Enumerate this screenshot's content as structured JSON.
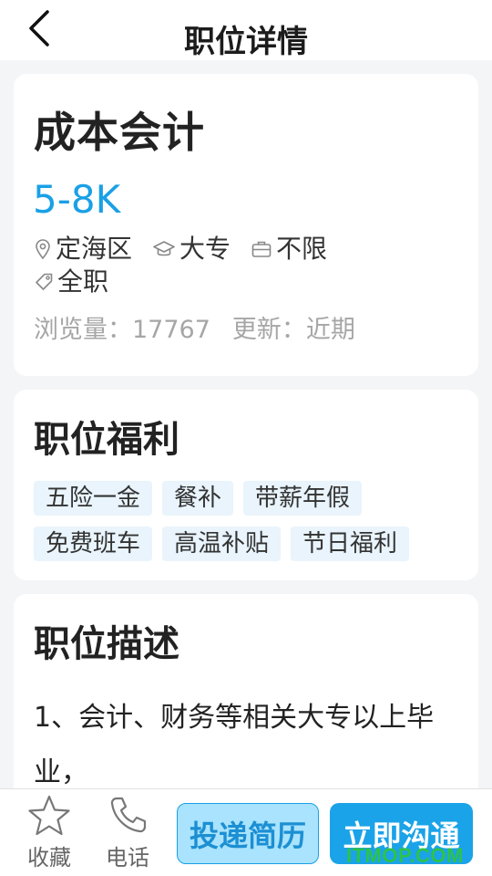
{
  "header": {
    "title": "职位详情",
    "back_icon": "chevron-left-icon"
  },
  "job": {
    "title": "成本会计",
    "salary": "5-8K",
    "location": "定海区",
    "education": "大专",
    "experience": "不限",
    "job_type": "全职",
    "views_label": "浏览量：",
    "views_value": "17767",
    "updated_label": "更新：",
    "updated_value": "近期"
  },
  "benefits": {
    "title": "职位福利",
    "tags": [
      "五险一金",
      "餐补",
      "带薪年假",
      "免费班车",
      "高温补贴",
      "节日福利"
    ]
  },
  "description": {
    "title": "职位描述",
    "text": "1、会计、财务等相关大专以上毕业，"
  },
  "bottom_bar": {
    "favorite_label": "收藏",
    "call_label": "电话",
    "resume_button": "投递简历",
    "chat_button": "立即沟通"
  },
  "watermark": "ITMOP.COM",
  "colors": {
    "accent": "#1aa0e6",
    "tag_background": "#e9f4fc",
    "resume_button_background": "#a9e3fd",
    "chat_button_background": "#1aa3e8",
    "muted_text": "#a6a6a6",
    "page_background": "#f4f5f7"
  }
}
